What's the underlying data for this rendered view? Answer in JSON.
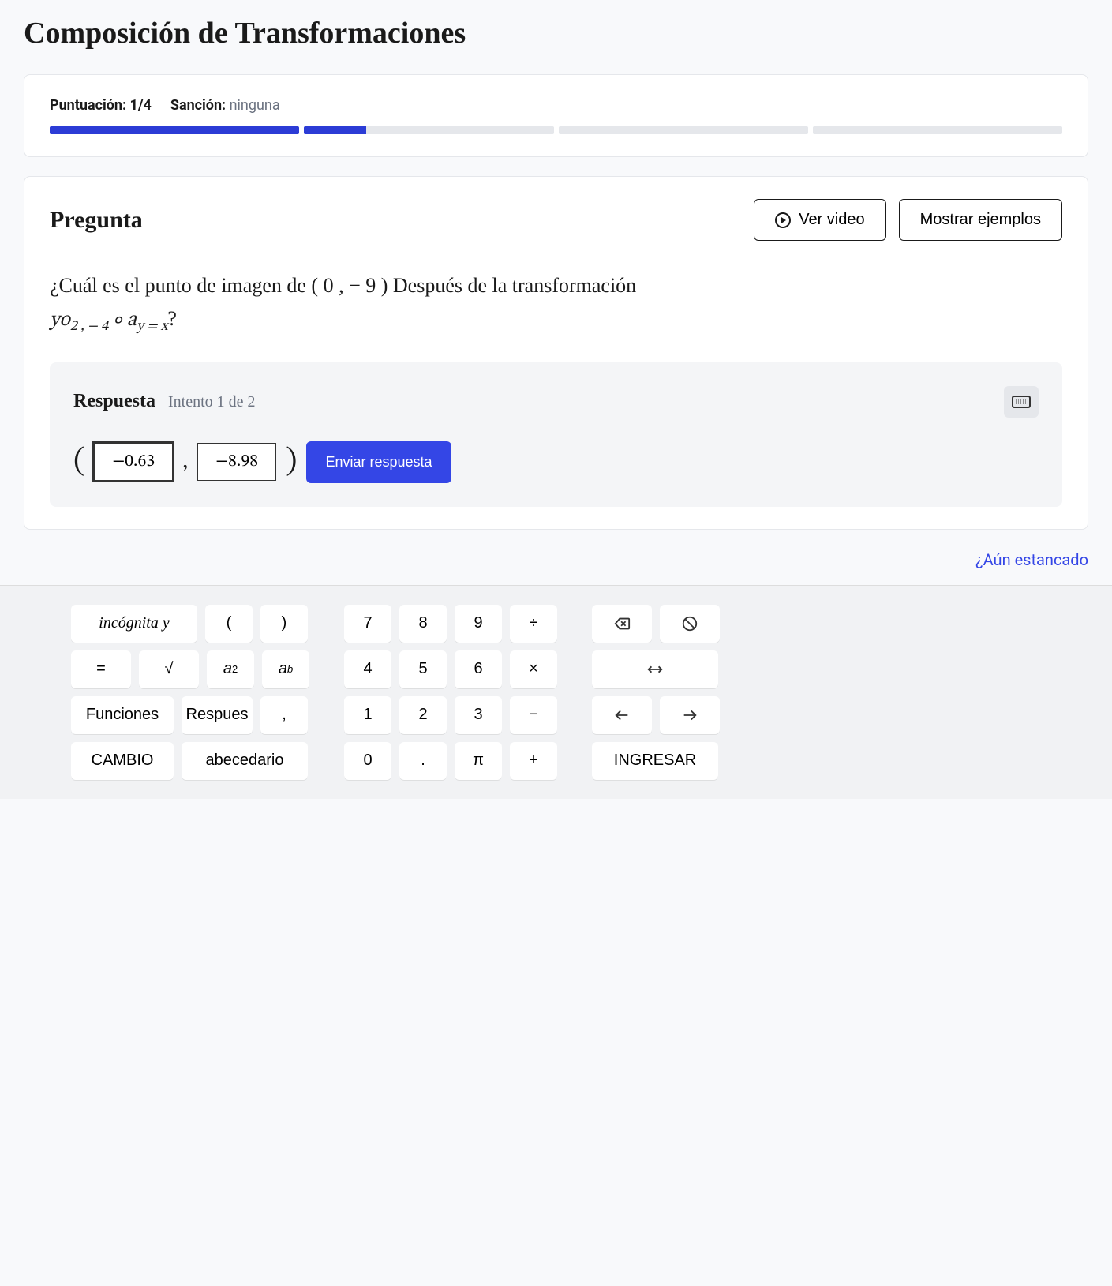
{
  "title": "Composición de Transformaciones",
  "score": {
    "label": "Puntuación:",
    "value": "1/4",
    "penalty_label": "Sanción:",
    "penalty_value": "ninguna"
  },
  "progress": {
    "segments": 4,
    "fill_percents": [
      100,
      25,
      0,
      0
    ]
  },
  "question": {
    "heading": "Pregunta",
    "watch_video": "Ver video",
    "show_examples": "Mostrar ejemplos",
    "text_before": "¿Cuál es el punto de imagen de",
    "point": "( 0 , − 9 )",
    "text_after": "Después de la transformación",
    "transform_html": "yo<sub>2 , − 4</sub> ∘ a<sub>y = x</sub>",
    "qmark": "?"
  },
  "answer": {
    "heading": "Respuesta",
    "attempt": "Intento 1 de 2",
    "input1": "−0.63",
    "input2": "−8.98",
    "submit": "Enviar respuesta"
  },
  "stuck_text": "¿Aún estancado",
  "keyboard": {
    "col1": [
      [
        "incógnita y",
        "(",
        ")"
      ],
      [
        "=",
        "√",
        "a²",
        "aᵇ"
      ],
      [
        "Funciones",
        "Respues",
        ","
      ],
      [
        "CAMBIO",
        "abecedario"
      ]
    ],
    "col2": [
      [
        "7",
        "8",
        "9",
        "÷"
      ],
      [
        "4",
        "5",
        "6",
        "×"
      ],
      [
        "1",
        "2",
        "3",
        "−"
      ],
      [
        "0",
        ".",
        "π",
        "+"
      ]
    ],
    "col3": [
      [
        "backspace-icon",
        "cancel-icon"
      ],
      [
        "lr-arrow-icon"
      ],
      [
        "left-icon",
        "right-icon"
      ],
      [
        "INGRESAR"
      ]
    ]
  }
}
